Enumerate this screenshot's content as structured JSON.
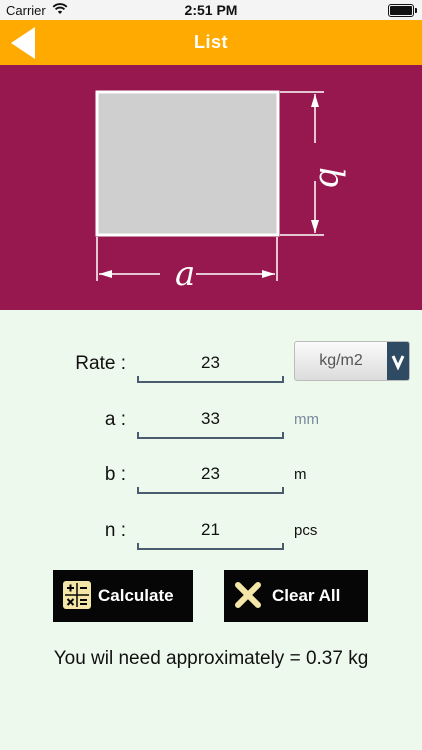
{
  "status_bar": {
    "carrier": "Carrier",
    "time": "2:51 PM",
    "wifi_icon": "wifi-icon",
    "battery_icon": "battery-icon"
  },
  "nav": {
    "title": "List",
    "back_icon": "back-arrow-icon",
    "color": "#ffaa00"
  },
  "diagram": {
    "background": "#96184f",
    "label_width": "a",
    "label_height": "b"
  },
  "form": {
    "rate": {
      "label": "Rate :",
      "value": "23",
      "unit_selected": "kg/m2"
    },
    "a": {
      "label": "a :",
      "value": "33",
      "unit": "mm"
    },
    "b": {
      "label": "b :",
      "value": "23",
      "unit": "m"
    },
    "n": {
      "label": "n :",
      "value": "21",
      "unit": "pcs"
    }
  },
  "buttons": {
    "calculate": "Calculate",
    "clear_all": "Clear All",
    "calculate_icon": "calculator-icon",
    "clear_icon": "x-icon"
  },
  "result": {
    "text": "You wil need approximately = 0.37 kg"
  }
}
